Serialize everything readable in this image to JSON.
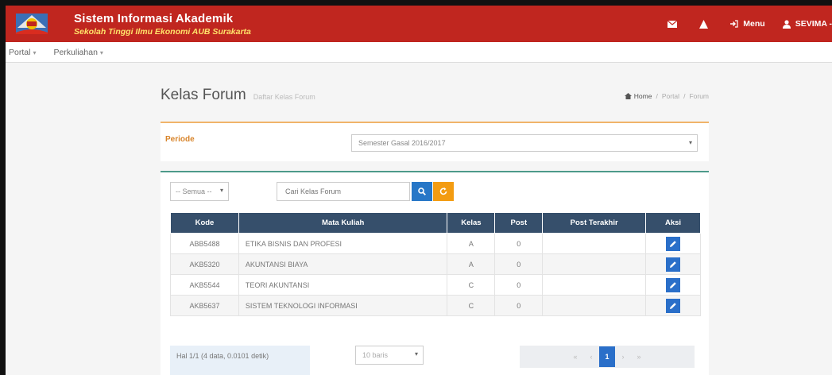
{
  "header": {
    "title": "Sistem Informasi Akademik",
    "subtitle": "Sekolah Tinggi Ilmu Ekonomi AUB Surakarta",
    "nav_menu": "Menu",
    "nav_user": "SEVIMA -"
  },
  "menubar": {
    "items": [
      {
        "label": "Portal"
      },
      {
        "label": "Perkuliahan"
      }
    ]
  },
  "page": {
    "title": "Kelas Forum",
    "description": "Daftar Kelas Forum",
    "breadcrumb": [
      "Home",
      "Portal",
      "Forum"
    ]
  },
  "periode": {
    "label": "Periode",
    "selected": "Semester Gasal 2016/2017"
  },
  "filter": {
    "selected": "-- Semua --",
    "search_placeholder": "Cari Kelas Forum"
  },
  "table": {
    "columns": [
      "Kode",
      "Mata Kuliah",
      "Kelas",
      "Post",
      "Post Terakhir",
      "Aksi"
    ],
    "rows": [
      {
        "kode": "ABB5488",
        "mata_kuliah": "ETIKA BISNIS DAN PROFESI",
        "kelas": "A",
        "post": "0",
        "post_terakhir": ""
      },
      {
        "kode": "AKB5320",
        "mata_kuliah": "AKUNTANSI BIAYA",
        "kelas": "A",
        "post": "0",
        "post_terakhir": ""
      },
      {
        "kode": "AKB5544",
        "mata_kuliah": "TEORI AKUNTANSI",
        "kelas": "C",
        "post": "0",
        "post_terakhir": ""
      },
      {
        "kode": "AKB5637",
        "mata_kuliah": "SISTEM TEKNOLOGI INFORMASI",
        "kelas": "C",
        "post": "0",
        "post_terakhir": ""
      }
    ]
  },
  "footer": {
    "info": "Hal 1/1 (4 data, 0.0101 detik)",
    "rows_per_page": "10 baris",
    "pager": [
      "«",
      "‹",
      "1",
      "›",
      "»"
    ],
    "current_page": "1"
  },
  "colors": {
    "header_bg": "#c0261f",
    "subtitle": "#ffe36a",
    "table_header": "#364f6b",
    "primary": "#2a6fc9",
    "warning": "#f39c12",
    "periode_accent": "#f0b46a",
    "table_accent": "#4d9a8a"
  },
  "icons": [
    "logo-emblem",
    "envelope-icon",
    "bell-icon",
    "sign-in-icon",
    "user-icon",
    "search-icon",
    "refresh-icon",
    "edit-icon"
  ]
}
